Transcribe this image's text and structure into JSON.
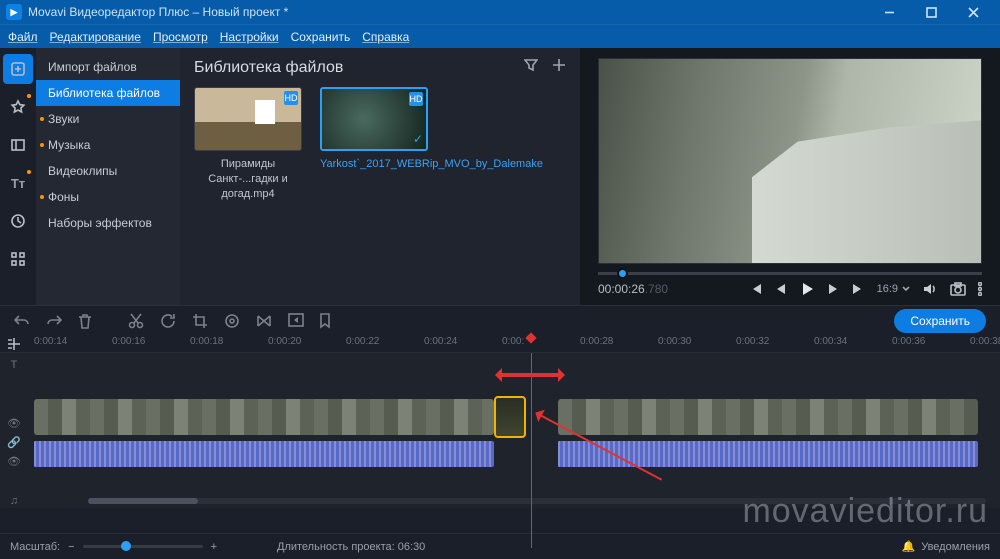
{
  "title": "Movavi Видеоредактор Плюс – Новый проект *",
  "menus": {
    "file": "Файл",
    "edit": "Редактирование",
    "view": "Просмотр",
    "settings": "Настройки",
    "save": "Сохранить",
    "help": "Справка"
  },
  "sidepanel": {
    "items": [
      {
        "label": "Импорт файлов"
      },
      {
        "label": "Библиотека файлов"
      },
      {
        "label": "Звуки"
      },
      {
        "label": "Музыка"
      },
      {
        "label": "Видеоклипы"
      },
      {
        "label": "Фоны"
      },
      {
        "label": "Наборы эффектов"
      }
    ]
  },
  "library": {
    "heading": "Библиотека файлов",
    "items": [
      {
        "caption": "Пирамиды Санкт-...гадки и догад.mp4",
        "hd": "HD"
      },
      {
        "caption": "Yarkost`_2017_WEBRip_MVO_by_Dalemake",
        "hd": "HD"
      }
    ]
  },
  "player": {
    "timecode": "00:00:26",
    "timecode_ms": ".780",
    "aspect": "16:9"
  },
  "toolbar": {
    "save": "Сохранить"
  },
  "ruler": {
    "ticks": [
      "0:00:14",
      "0:00:16",
      "0:00:18",
      "0:00:20",
      "0:00:22",
      "0:00:24",
      "0:00:28",
      "0:00:30",
      "0:00:32",
      "0:00:34",
      "0:00:36",
      "0:00:38"
    ],
    "partial": "0:00:"
  },
  "status": {
    "zoom_label": "Масштаб:",
    "duration_label": "Длительность проекта:",
    "duration_value": "06:30",
    "notifications": "Уведомления"
  },
  "watermark": "movavieditor.ru"
}
